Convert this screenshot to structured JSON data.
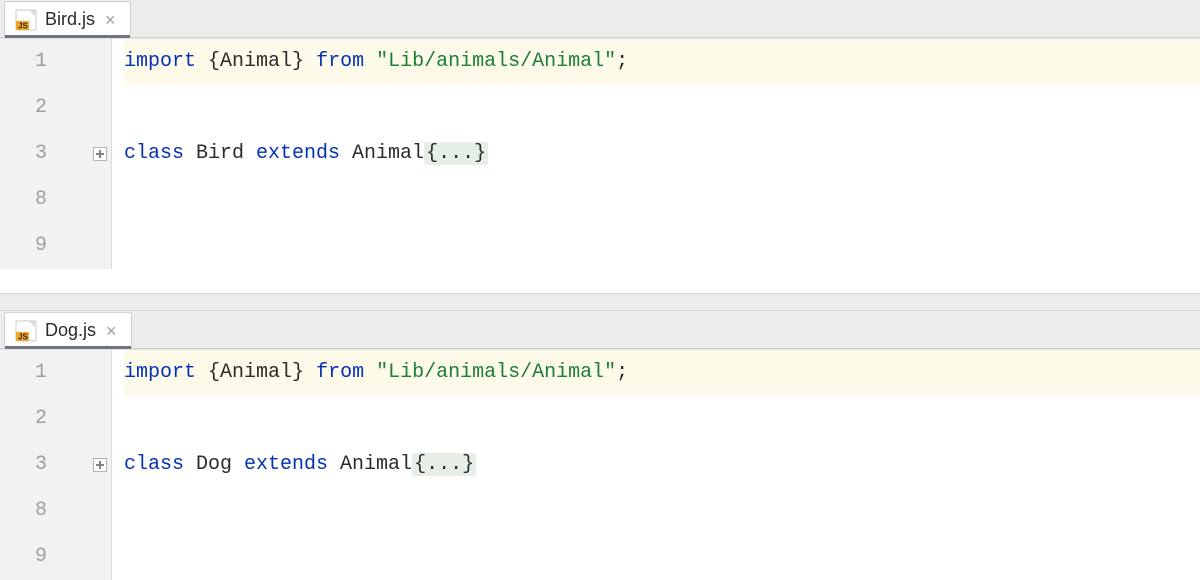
{
  "panes": [
    {
      "tab": {
        "filename": "Bird.js",
        "icon": "js-file-icon"
      },
      "lines": [
        {
          "n": "1",
          "highlight": true,
          "fold": false,
          "tokens": [
            {
              "t": "import ",
              "c": "kw"
            },
            {
              "t": "{",
              "c": "punc"
            },
            {
              "t": "Animal",
              "c": "id"
            },
            {
              "t": "}",
              "c": "punc"
            },
            {
              "t": " ",
              "c": "id"
            },
            {
              "t": "from ",
              "c": "kw"
            },
            {
              "t": "\"Lib/animals/Animal\"",
              "c": "str"
            },
            {
              "t": ";",
              "c": "punc"
            }
          ]
        },
        {
          "n": "2",
          "highlight": false,
          "fold": false,
          "tokens": []
        },
        {
          "n": "3",
          "highlight": false,
          "fold": true,
          "tokens": [
            {
              "t": "class ",
              "c": "kw"
            },
            {
              "t": "Bird ",
              "c": "id"
            },
            {
              "t": "extends ",
              "c": "kw"
            },
            {
              "t": "Animal",
              "c": "id"
            },
            {
              "t": "{...}",
              "c": "folded"
            }
          ]
        },
        {
          "n": "8",
          "highlight": false,
          "fold": false,
          "tokens": []
        },
        {
          "n": "9",
          "highlight": false,
          "fold": false,
          "tokens": []
        }
      ]
    },
    {
      "tab": {
        "filename": "Dog.js",
        "icon": "js-file-icon"
      },
      "lines": [
        {
          "n": "1",
          "highlight": true,
          "fold": false,
          "tokens": [
            {
              "t": "import ",
              "c": "kw"
            },
            {
              "t": "{",
              "c": "punc"
            },
            {
              "t": "Animal",
              "c": "id"
            },
            {
              "t": "}",
              "c": "punc"
            },
            {
              "t": " ",
              "c": "id"
            },
            {
              "t": "from ",
              "c": "kw"
            },
            {
              "t": "\"Lib/animals/Animal\"",
              "c": "str"
            },
            {
              "t": ";",
              "c": "punc"
            }
          ]
        },
        {
          "n": "2",
          "highlight": false,
          "fold": false,
          "tokens": []
        },
        {
          "n": "3",
          "highlight": false,
          "fold": true,
          "tokens": [
            {
              "t": "class ",
              "c": "kw"
            },
            {
              "t": "Dog ",
              "c": "id"
            },
            {
              "t": "extends ",
              "c": "kw"
            },
            {
              "t": "Animal",
              "c": "id"
            },
            {
              "t": "{...}",
              "c": "folded"
            }
          ]
        },
        {
          "n": "8",
          "highlight": false,
          "fold": false,
          "tokens": []
        },
        {
          "n": "9",
          "highlight": false,
          "fold": false,
          "tokens": []
        }
      ]
    }
  ],
  "closeGlyph": "×"
}
